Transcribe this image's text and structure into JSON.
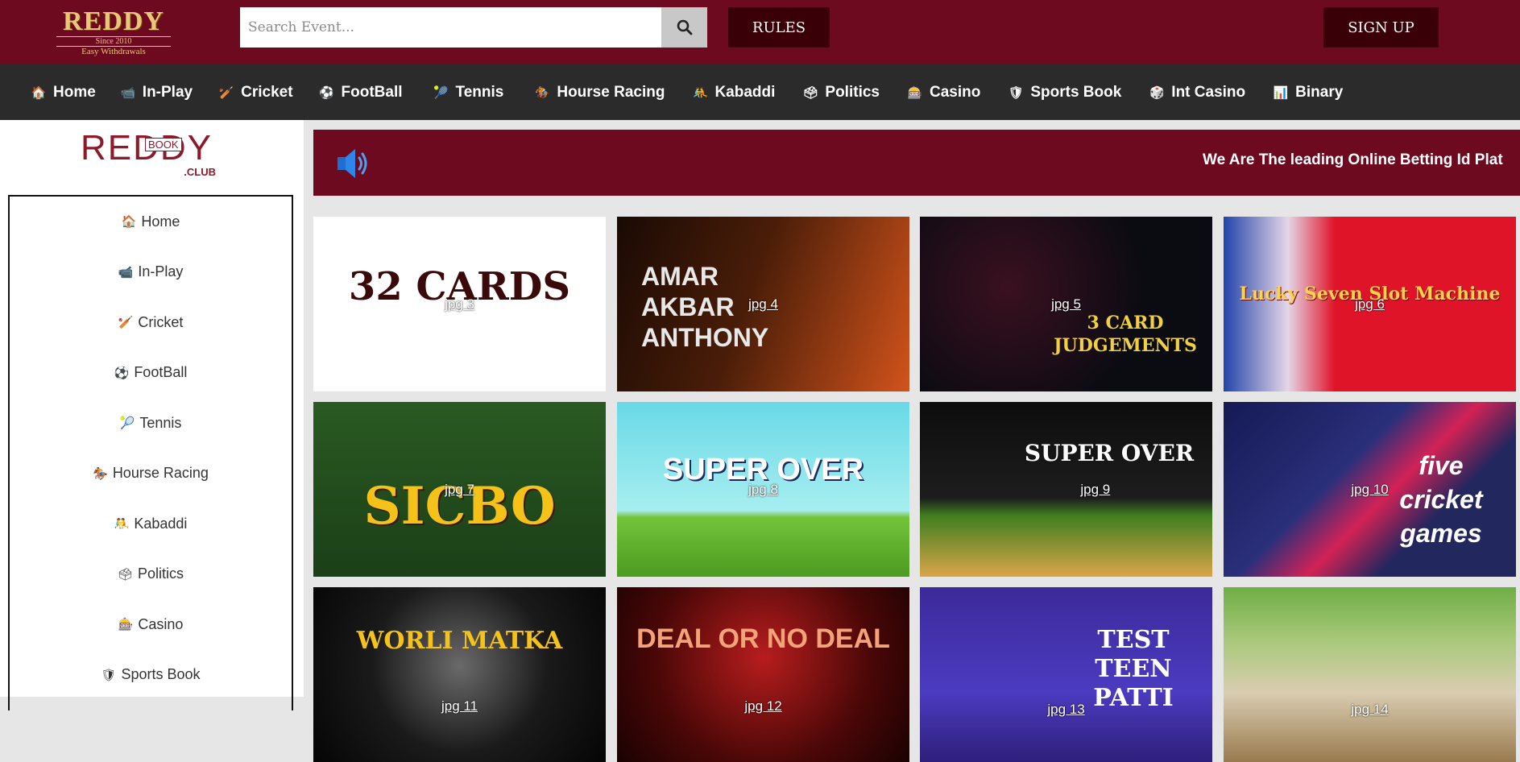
{
  "header": {
    "logo": {
      "brand": "REDDY",
      "since": "Since 2010",
      "tagline": "Easy Withdrawals"
    },
    "search": {
      "placeholder": "Search Event...",
      "button_icon": "search-icon"
    },
    "rules_label": "RULES",
    "signup_label": "SIGN UP"
  },
  "nav": {
    "items": [
      {
        "label": "Home",
        "icon": "home-icon",
        "glyph": "🏠"
      },
      {
        "label": "In-Play",
        "icon": "camera-icon",
        "glyph": "📹"
      },
      {
        "label": "Cricket",
        "icon": "cricket-icon",
        "glyph": "🏏"
      },
      {
        "label": "FootBall",
        "icon": "football-icon",
        "glyph": "⚽"
      },
      {
        "label": "Tennis",
        "icon": "tennis-icon",
        "glyph": "🎾"
      },
      {
        "label": "Hourse Racing",
        "icon": "horse-racing-icon",
        "glyph": "🏇"
      },
      {
        "label": "Kabaddi",
        "icon": "kabaddi-icon",
        "glyph": "🤼"
      },
      {
        "label": "Politics",
        "icon": "ballot-icon",
        "glyph": "🗳"
      },
      {
        "label": "Casino",
        "icon": "slot-machine-icon",
        "glyph": "🎰"
      },
      {
        "label": "Sports Book",
        "icon": "shield-icon",
        "glyph": "🛡"
      },
      {
        "label": "Int Casino",
        "icon": "dice-icon",
        "glyph": "🎲"
      },
      {
        "label": "Binary",
        "icon": "chart-icon",
        "glyph": "📊"
      }
    ]
  },
  "sidebar": {
    "logo": {
      "main": "REDDY",
      "book": "BOOK",
      "club": ".CLUB"
    },
    "items": [
      {
        "label": "Home",
        "icon": "home-icon",
        "glyph": "🏠"
      },
      {
        "label": "In-Play",
        "icon": "camera-icon",
        "glyph": "📹"
      },
      {
        "label": "Cricket",
        "icon": "cricket-icon",
        "glyph": "🏏"
      },
      {
        "label": "FootBall",
        "icon": "football-icon",
        "glyph": "⚽"
      },
      {
        "label": "Tennis",
        "icon": "tennis-icon",
        "glyph": "🎾"
      },
      {
        "label": "Hourse Racing",
        "icon": "horse-racing-icon",
        "glyph": "🏇"
      },
      {
        "label": "Kabaddi",
        "icon": "kabaddi-icon",
        "glyph": "🤼"
      },
      {
        "label": "Politics",
        "icon": "ballot-icon",
        "glyph": "🗳"
      },
      {
        "label": "Casino",
        "icon": "slot-machine-icon",
        "glyph": "🎰"
      },
      {
        "label": "Sports Book",
        "icon": "shield-icon",
        "glyph": "🛡"
      }
    ]
  },
  "banner": {
    "icon": "speaker-icon",
    "marquee": "We Are The leading Online Betting Id Plat"
  },
  "games": [
    {
      "label": "jpg 3",
      "title": "32 CARDS"
    },
    {
      "label": "jpg 4",
      "title": "AMAR AKBAR ANTHONY"
    },
    {
      "label": "jpg 5",
      "title": "3 CARD JUDGEMENTS"
    },
    {
      "label": "jpg 6",
      "title": "Lucky Seven Slot Machine"
    },
    {
      "label": "jpg 7",
      "title": "SICBO"
    },
    {
      "label": "jpg 8",
      "title": "SUPER OVER"
    },
    {
      "label": "jpg 9",
      "title": "SUPER OVER"
    },
    {
      "label": "jpg 10",
      "title": "five cricket games"
    },
    {
      "label": "jpg 11",
      "title": "WORLI MATKA"
    },
    {
      "label": "jpg 12",
      "title": "DEAL OR NO DEAL"
    },
    {
      "label": "jpg 13",
      "title": "TEST TEEN PATTI"
    },
    {
      "label": "jpg 14",
      "title": ""
    }
  ],
  "colors": {
    "brand": "#6d0a20",
    "button": "#3a0008",
    "nav": "#2b2b2b",
    "gold": "#e9c77a"
  }
}
